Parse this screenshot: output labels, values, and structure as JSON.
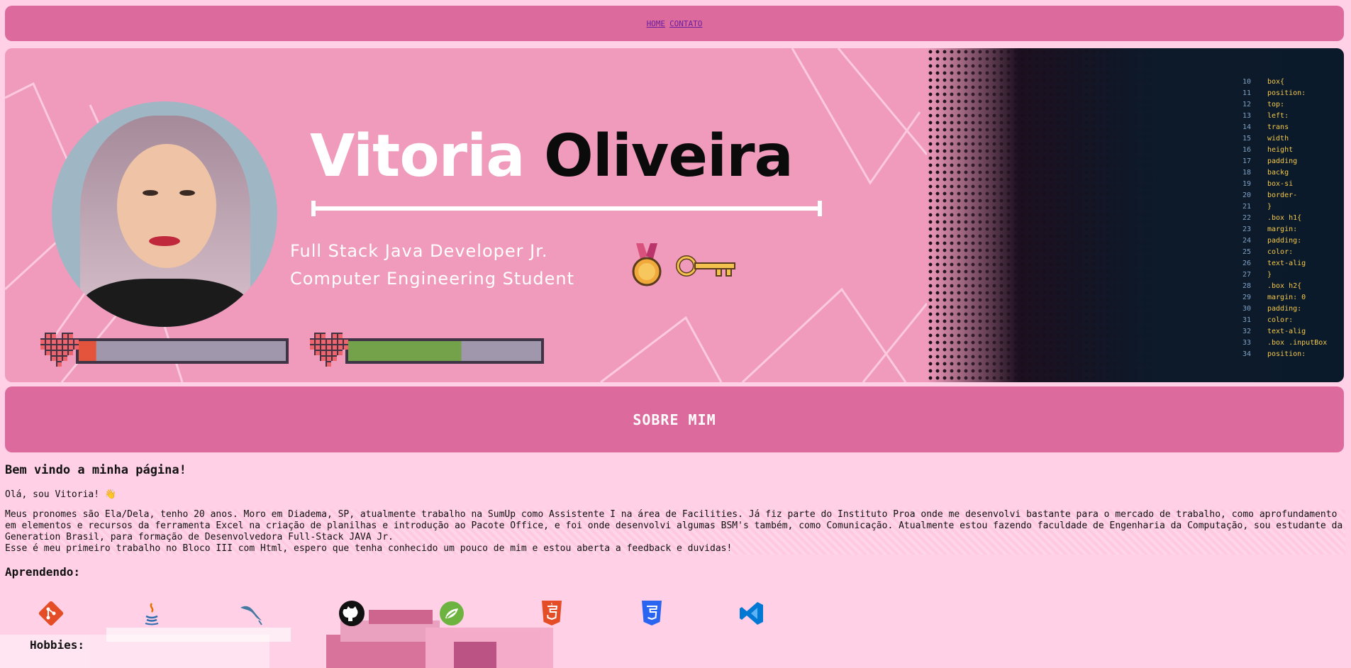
{
  "nav": {
    "links": [
      {
        "label": "HOME"
      },
      {
        "label": "CONTATO"
      }
    ]
  },
  "banner": {
    "first_name": "Vitoria",
    "last_name": "Oliveira",
    "role_line1": "Full Stack Java Developer Jr.",
    "role_line2": "Computer Engineering Student",
    "hearts": [
      {
        "fill_fraction": 0.05
      },
      {
        "fill_fraction": 0.55
      }
    ],
    "code_snippet": [
      "box{",
      "position:",
      "top:",
      "left:",
      "trans",
      "width",
      "height",
      "padding",
      "backg",
      "box-si",
      "border-",
      "}",
      ".box h1{",
      "margin:",
      "padding:",
      "color:",
      "text-alig",
      "}",
      ".box h2{",
      "margin: 0",
      "padding:",
      "color:",
      "text-alig",
      ".box .inputBox",
      "position:"
    ]
  },
  "sobre": {
    "title": "SOBRE MIM"
  },
  "content": {
    "welcome": "Bem vindo a minha página!",
    "hello": "Olá, sou Vitoria! 👋",
    "paragraph1": "Meus pronomes são Ela/Dela, tenho 20 anos. Moro em Diadema, SP, atualmente trabalho na SumUp como Assistente I na área de Facilities. Já fiz parte do Instituto Proa onde me desenvolvi bastante para o mercado de trabalho, como aprofundamento em elementos e recursos da ferramenta Excel na criação de planilhas e introdução ao Pacote Office, e foi onde desenvolvi algumas BSM's também, como Comunicação. Atualmente estou fazendo faculdade de Engenharia da Computação, sou estudante da Generation Brasil, para formação de Desenvolvedora Full-Stack JAVA Jr.",
    "paragraph2": "Esse é meu primeiro trabalho no Bloco III com Html, espero que tenha conhecido um pouco de mim e estou aberta a feedback e duvidas!",
    "learning_title": "Aprendendo:",
    "skills": [
      {
        "icon": "git-icon",
        "color": "#e44d26"
      },
      {
        "icon": "java-icon",
        "color": "#2f6fb0"
      },
      {
        "icon": "mysql-icon",
        "color": "#4479a1"
      },
      {
        "icon": "github-icon",
        "color": "#111111"
      },
      {
        "icon": "spring-icon",
        "color": "#6db33f"
      },
      {
        "icon": "html5-icon",
        "color": "#e44d26"
      },
      {
        "icon": "css3-icon",
        "color": "#2965f1"
      },
      {
        "icon": "vscode-icon",
        "color": "#0078d4"
      }
    ],
    "hobbies_title": "Hobbies:"
  }
}
